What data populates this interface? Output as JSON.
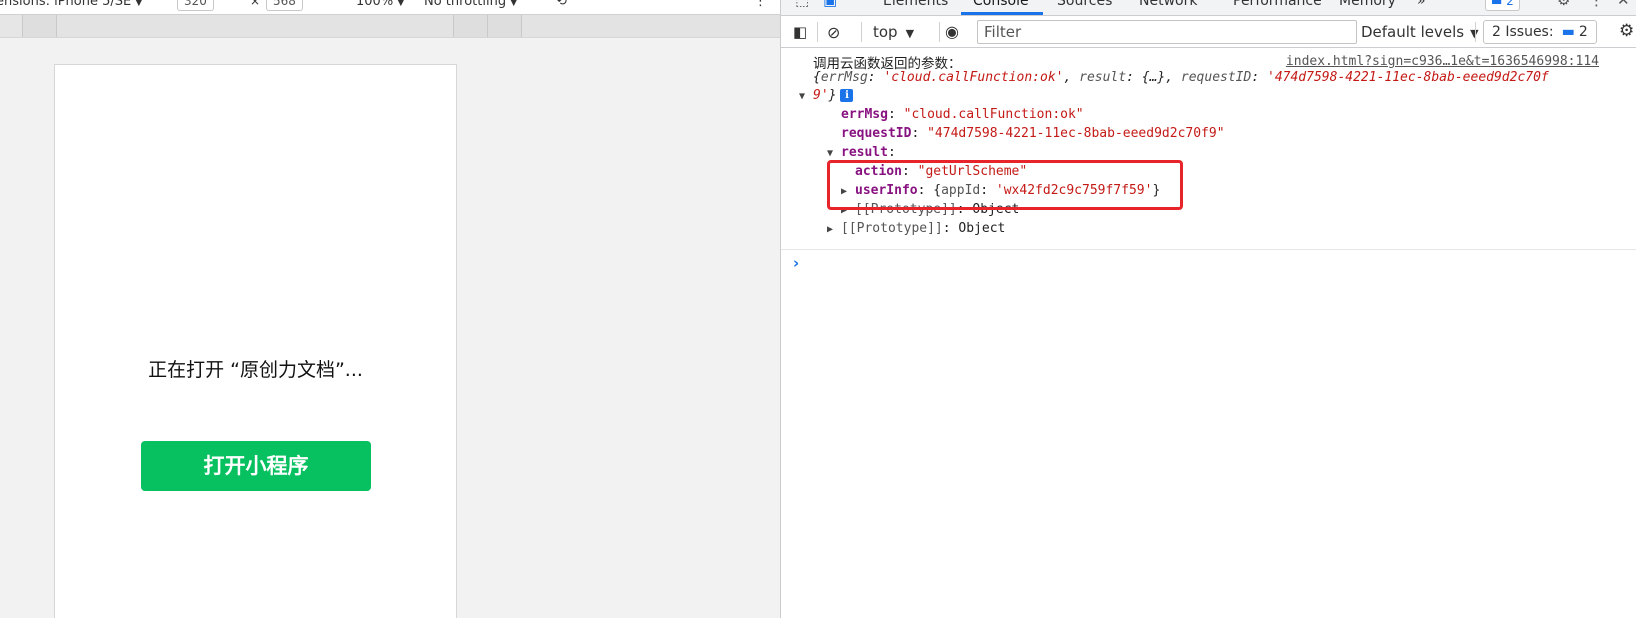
{
  "device_toolbar": {
    "dimensions_label": "ensions: iPhone 5/SE",
    "width_value": "320",
    "height_value": "568",
    "zoom": "100%",
    "throttling": "No throttling"
  },
  "phone": {
    "opening_text": "正在打开 “原创力文档”...",
    "open_button_label": "打开小程序",
    "open_button_color": "#07c160"
  },
  "devtools": {
    "tabs": [
      "Elements",
      "Console",
      "Sources",
      "Network",
      "Performance",
      "Memory",
      "»"
    ],
    "active_tab": "Console",
    "tab_badge_count": "2",
    "accent_color": "#1a73e8",
    "console_toolbar": {
      "context": "top",
      "filter_placeholder": "Filter",
      "filter_value": "",
      "log_levels": "Default levels",
      "issues_label": "2 Issues:",
      "issues_count": "2"
    },
    "console": {
      "log_title": "调用云函数返回的参数：",
      "source_link": "index.html?sign=c936…1e&t=1636546998:114",
      "summary": {
        "open": "{",
        "errMsg_key": "errMsg",
        "errMsg_value": "'cloud.callFunction:ok'",
        "result_key": "result",
        "result_value": "{…}",
        "requestID_key": "requestID",
        "requestID_value_part1": "'474d7598-4221-11ec-8bab-eeed9d2c70f",
        "requestID_value_part2": "9'",
        "close": "}"
      },
      "properties": {
        "errMsg_key": "errMsg",
        "errMsg_value": "\"cloud.callFunction:ok\"",
        "requestID_key": "requestID",
        "requestID_value": "\"474d7598-4221-11ec-8bab-eeed9d2c70f9\"",
        "result_key": "result",
        "action_key": "action",
        "action_value": "\"getUrlScheme\"",
        "userInfo_key": "userInfo",
        "userInfo_preview_key": "appId",
        "userInfo_preview_value": "'wx42fd2c9c759f7f59'",
        "prototype_inner": "[[Prototype]]",
        "prototype_inner_value": "Object",
        "prototype_outer": "[[Prototype]]",
        "prototype_outer_value": "Object"
      },
      "prompt_symbol": "›",
      "highlight_color": "#e8242b"
    }
  }
}
